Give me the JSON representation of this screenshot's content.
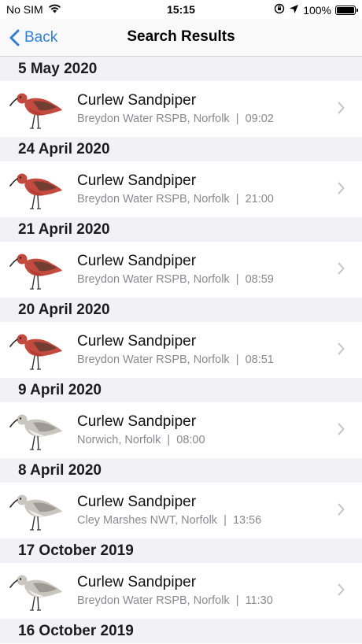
{
  "status_bar": {
    "carrier": "No SIM",
    "time": "15:15",
    "battery": "100%",
    "battery_level": 1.0
  },
  "nav": {
    "back_label": "Back",
    "title": "Search Results"
  },
  "sections": [
    {
      "date": "5 May 2020",
      "items": [
        {
          "species": "Curlew Sandpiper",
          "location": "Breydon Water RSPB, Norfolk",
          "time": "09:02",
          "plumage": "breeding-red"
        }
      ]
    },
    {
      "date": "24 April 2020",
      "items": [
        {
          "species": "Curlew Sandpiper",
          "location": "Breydon Water RSPB, Norfolk",
          "time": "21:00",
          "plumage": "breeding-red"
        }
      ]
    },
    {
      "date": "21 April 2020",
      "items": [
        {
          "species": "Curlew Sandpiper",
          "location": "Breydon Water RSPB, Norfolk",
          "time": "08:59",
          "plumage": "breeding-red"
        }
      ]
    },
    {
      "date": "20 April 2020",
      "items": [
        {
          "species": "Curlew Sandpiper",
          "location": "Breydon Water RSPB, Norfolk",
          "time": "08:51",
          "plumage": "breeding-red"
        }
      ]
    },
    {
      "date": "9 April 2020",
      "items": [
        {
          "species": "Curlew Sandpiper",
          "location": "Norwich, Norfolk",
          "time": "08:00",
          "plumage": "winter-grey"
        }
      ]
    },
    {
      "date": "8 April 2020",
      "items": [
        {
          "species": "Curlew Sandpiper",
          "location": "Cley Marshes NWT, Norfolk",
          "time": "13:56",
          "plumage": "winter-grey"
        }
      ]
    },
    {
      "date": "17 October 2019",
      "items": [
        {
          "species": "Curlew Sandpiper",
          "location": "Breydon Water RSPB, Norfolk",
          "time": "11:30",
          "plumage": "winter-grey"
        }
      ]
    },
    {
      "date": "16 October 2019",
      "items": []
    }
  ]
}
